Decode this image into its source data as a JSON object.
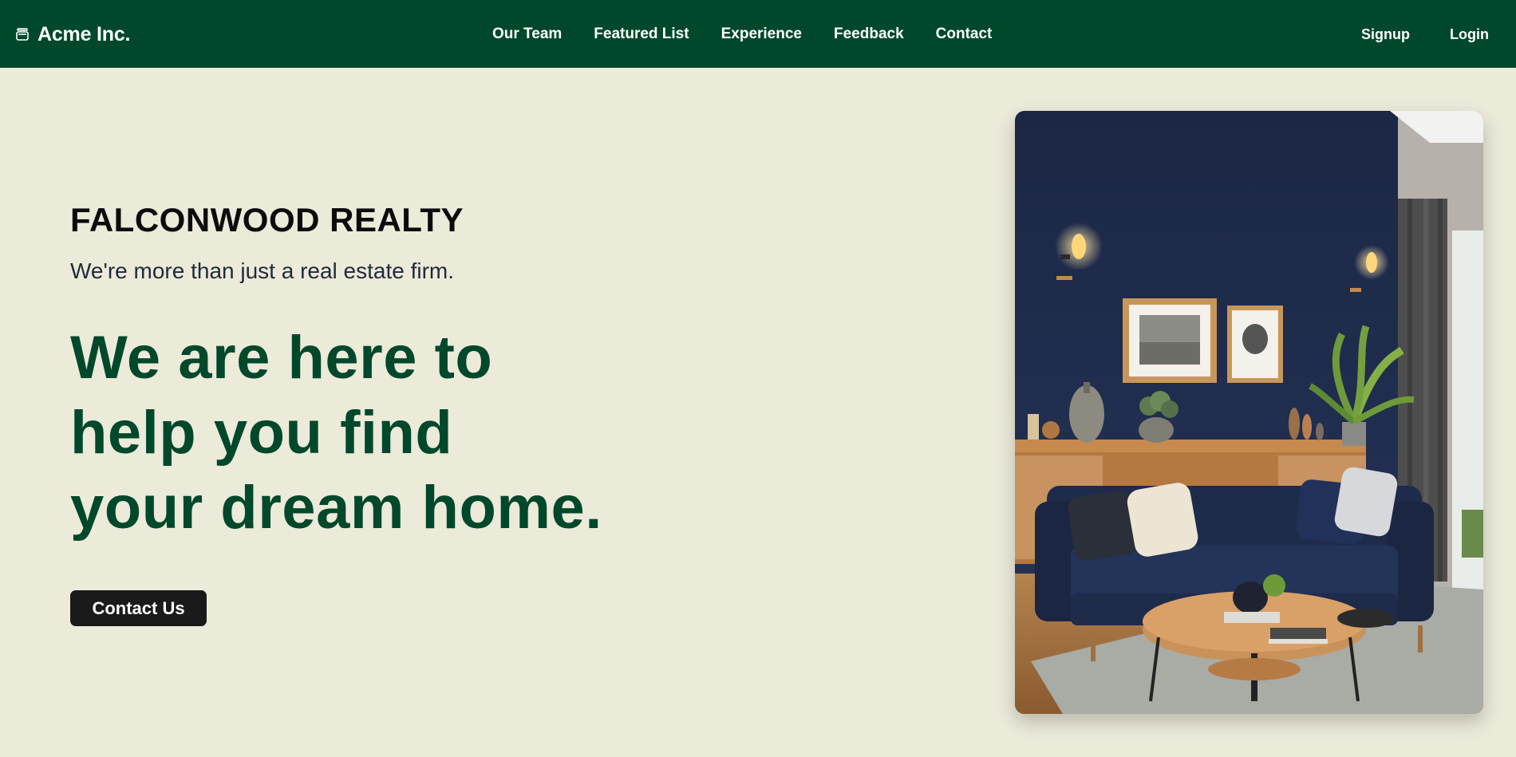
{
  "navbar": {
    "brand": {
      "name": "Acme Inc.",
      "icon": "stack-icon"
    },
    "links": [
      "Our Team",
      "Featured List",
      "Experience",
      "Feedback",
      "Contact"
    ],
    "auth": {
      "signup": "Signup",
      "login": "Login"
    },
    "background_color": "#00482b"
  },
  "hero": {
    "company": "FALCONWOOD REALTY",
    "subtitle": "We're more than just a real estate firm.",
    "headline_lines": [
      "We are here to",
      "help you find",
      "your dream home."
    ],
    "cta_label": "Contact Us",
    "image": {
      "description_icon": "living-room-photo"
    }
  },
  "colors": {
    "page_bg": "#ecead9",
    "accent_green": "#00482b",
    "button_bg": "#1a1a1a"
  }
}
